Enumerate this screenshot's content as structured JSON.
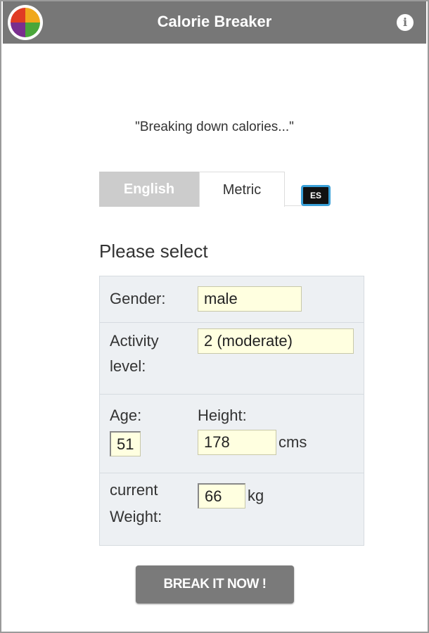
{
  "header": {
    "title": "Calorie Breaker",
    "logo_icon": "pie-logo-icon",
    "info_icon": "info-icon",
    "info_label": "i",
    "background": "#777777"
  },
  "tagline": "\"Breaking down calories...\"",
  "tabs": [
    {
      "label": "English",
      "active": false
    },
    {
      "label": "Metric",
      "active": true
    }
  ],
  "language_badge": "ES",
  "form": {
    "title": "Please select",
    "gender_label": "Gender:",
    "gender_value": "male",
    "activity_label_line1": "Activity",
    "activity_label_line2": "level:",
    "activity_value": "2 (moderate)",
    "age_label": "Age:",
    "age_value": "51",
    "height_label": "Height:",
    "height_value": "178",
    "height_unit": "cms",
    "weight_label_line1": "current",
    "weight_label_line2": "Weight:",
    "weight_value": "66",
    "weight_unit": "kg"
  },
  "submit_label": "BREAK IT NOW !",
  "colors": {
    "header": "#777777",
    "input_bg": "#ffffe0",
    "form_bg": "#edf0f3",
    "button": "#7a7a7a",
    "logo": [
      "#e03b24",
      "#f0a81c",
      "#4aa63a",
      "#7a2e8e"
    ]
  }
}
